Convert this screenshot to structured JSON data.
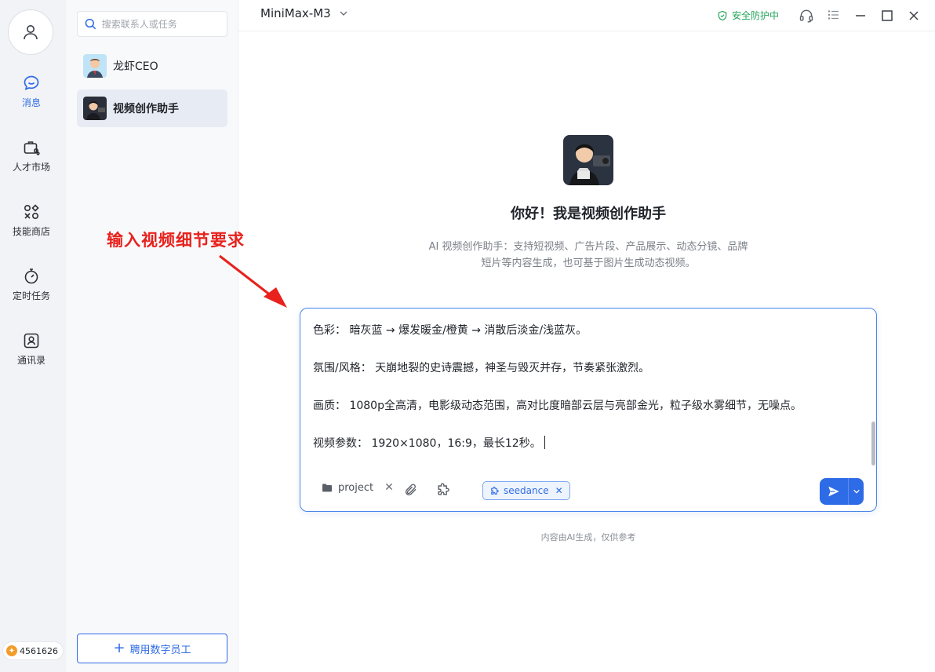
{
  "nav": {
    "items": [
      {
        "label": "消息",
        "icon": "chat-icon",
        "active": true
      },
      {
        "label": "人才市场",
        "icon": "briefcase-icon",
        "active": false
      },
      {
        "label": "技能商店",
        "icon": "apps-icon",
        "active": false
      },
      {
        "label": "定时任务",
        "icon": "timer-icon",
        "active": false
      },
      {
        "label": "通讯录",
        "icon": "contacts-icon",
        "active": false
      }
    ],
    "points": "4561626"
  },
  "contacts": {
    "search_placeholder": "搜索联系人或任务",
    "items": [
      {
        "name": "龙虾CEO",
        "active": false
      },
      {
        "name": "视频创作助手",
        "active": true
      }
    ],
    "hire_label": "聘用数字员工"
  },
  "header": {
    "model_name": "MiniMax-M3",
    "security_label": "安全防护中"
  },
  "welcome": {
    "title": "你好！我是视频创作助手",
    "desc_line1": "AI 视频创作助手：支持短视频、广告片段、产品展示、动态分镜、品牌",
    "desc_line2": "短片等内容生成，也可基于图片生成动态视频。"
  },
  "annotation": {
    "text": "输入视频细节要求",
    "color": "#e8211c"
  },
  "composer": {
    "lines": [
      "色彩： 暗灰蓝 → 爆发暖金/橙黄 → 消散后淡金/浅蓝灰。",
      "氛围/风格： 天崩地裂的史诗震撼，神圣与毁灭并存，节奏紧张激烈。",
      "画质： 1080p全高清，电影级动态范围，高对比度暗部云层与亮部金光，粒子级水雾细节，无噪点。",
      "视频参数： 1920×1080，16:9，最长12秒。"
    ],
    "project_label": "project",
    "skill_label": "seedance"
  },
  "disclaimer": "内容由AI生成，仅供参考",
  "colors": {
    "accent": "#2e6be6",
    "security": "#23a55a"
  }
}
